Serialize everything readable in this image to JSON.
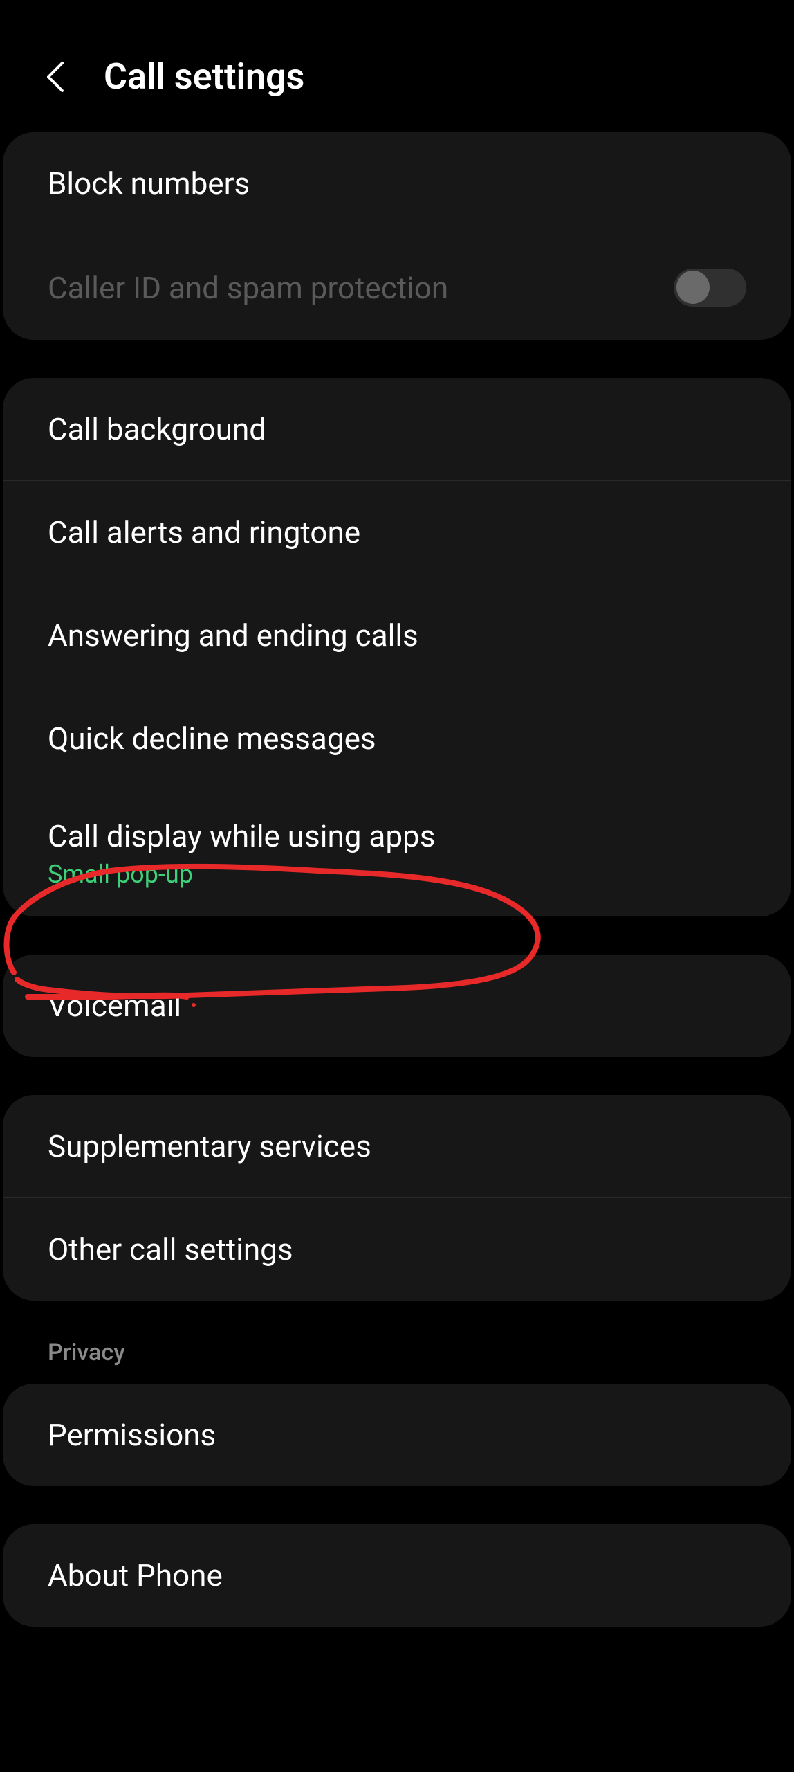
{
  "header": {
    "title": "Call settings"
  },
  "sections": {
    "first": {
      "block_numbers": "Block numbers",
      "caller_id": "Caller ID and spam protection"
    },
    "second": {
      "call_background": "Call background",
      "call_alerts": "Call alerts and ringtone",
      "answering": "Answering and ending calls",
      "quick_decline": "Quick decline messages",
      "call_display": "Call display while using apps",
      "call_display_sub": "Small pop-up"
    },
    "third": {
      "voicemail": "Voicemail"
    },
    "fourth": {
      "supplementary": "Supplementary services",
      "other": "Other call settings"
    },
    "privacy_header": "Privacy",
    "fifth": {
      "permissions": "Permissions"
    },
    "sixth": {
      "about": "About Phone"
    }
  },
  "annotation": {
    "color": "#e82929"
  }
}
